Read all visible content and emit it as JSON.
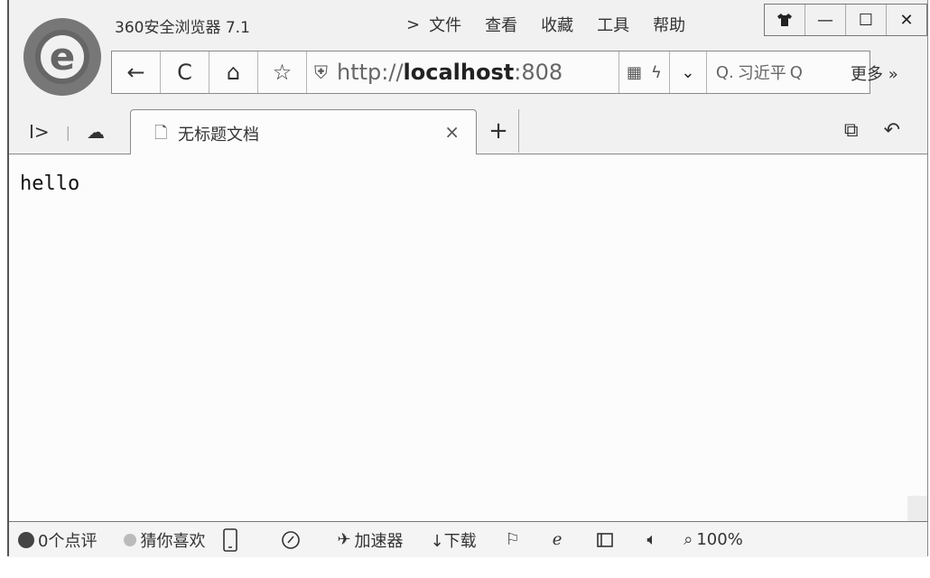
{
  "app": {
    "title": "360安全浏览器 7.1",
    "logo_letter": "e"
  },
  "menu": {
    "chevron": ">",
    "items": [
      "文件",
      "查看",
      "收藏",
      "工具",
      "帮助"
    ]
  },
  "window_controls": {
    "skin_icon": "shirt-icon",
    "minimize": "—",
    "maximize": "☐",
    "close": "✕"
  },
  "nav": {
    "back": "←",
    "refresh": "C",
    "home": "⌂",
    "favorite": "☆"
  },
  "address": {
    "prefix": "http://",
    "host": "localhost",
    "port": ":808",
    "qr_icon": "▦",
    "lightning_icon": "ϟ",
    "dropdown": "⌄"
  },
  "search": {
    "icon": "Q.",
    "query": "习近平",
    "submit_icon": "Q"
  },
  "more": {
    "label": "更多 »"
  },
  "tabs": {
    "left_icons": [
      "I>",
      "|",
      "☁"
    ],
    "active": {
      "icon": "🗋",
      "title": "无标题文档",
      "close": "×"
    },
    "new_tab": "+",
    "right_icons": [
      "⧉",
      "↶"
    ]
  },
  "content": {
    "text": "hello"
  },
  "statusbar": {
    "comments": "0个点评",
    "guess": "猜你喜欢",
    "accelerator": "加速器",
    "download": "↓下载",
    "zoom": "100%"
  }
}
